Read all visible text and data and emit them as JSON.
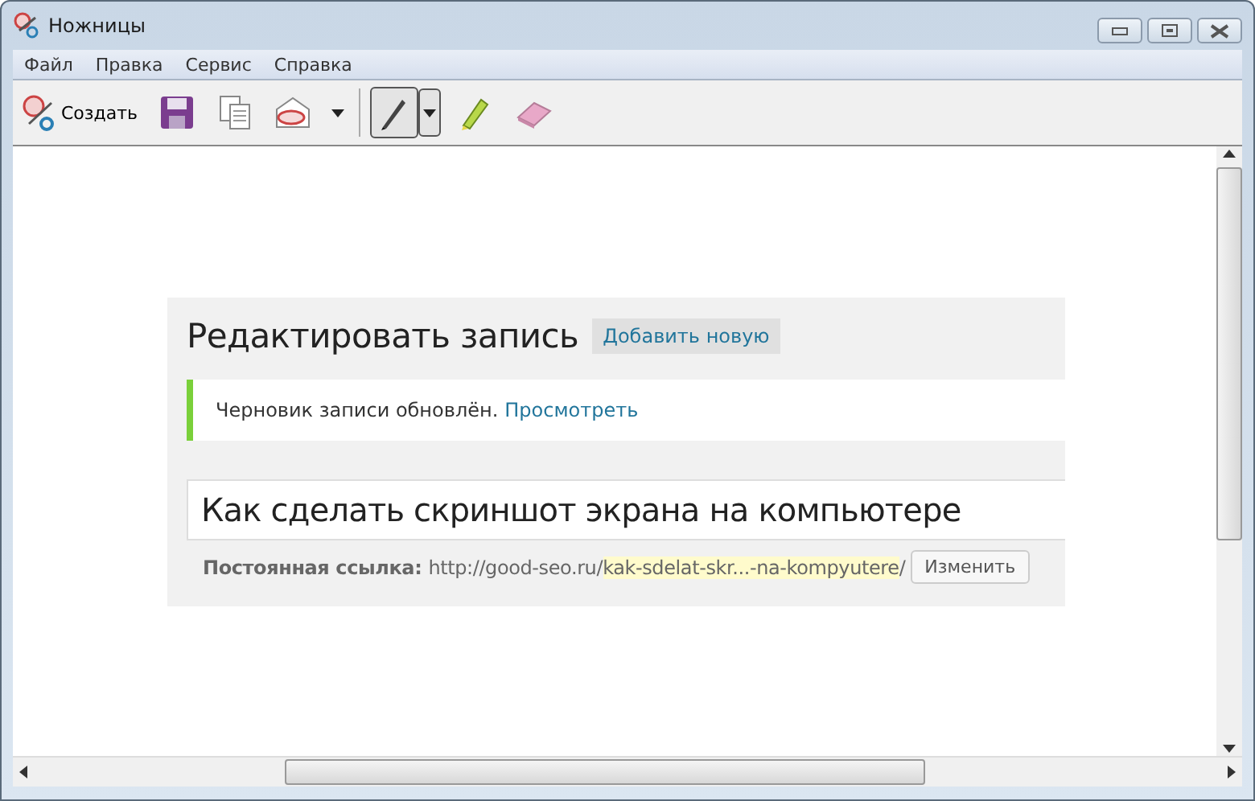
{
  "window": {
    "title": "Ножницы"
  },
  "menu": [
    "Файл",
    "Правка",
    "Сервис",
    "Справка"
  ],
  "toolbar": {
    "new_button": {
      "label": "Создать"
    },
    "actions": [
      {
        "kind": "save"
      },
      {
        "kind": "copy"
      },
      {
        "kind": "send"
      }
    ],
    "tools": [
      {
        "kind": "pen",
        "selected": true
      },
      {
        "kind": "highlighter",
        "selected": false
      },
      {
        "kind": "eraser",
        "selected": false
      }
    ]
  },
  "capture": {
    "heading": "Редактировать запись",
    "add_button": "Добавить новую",
    "notice": {
      "text": "Черновик записи обновлён.",
      "link": "Просмотреть"
    },
    "post_title": "Как сделать скриншот экрана на компьютере",
    "permalink": {
      "label": "Постоянная ссылка:",
      "url_base": "http://good-seo.ru/",
      "url_slug": "kak-sdelat-skr...-na-kompyutere",
      "url_end": "/",
      "edit_button": "Изменить"
    }
  }
}
